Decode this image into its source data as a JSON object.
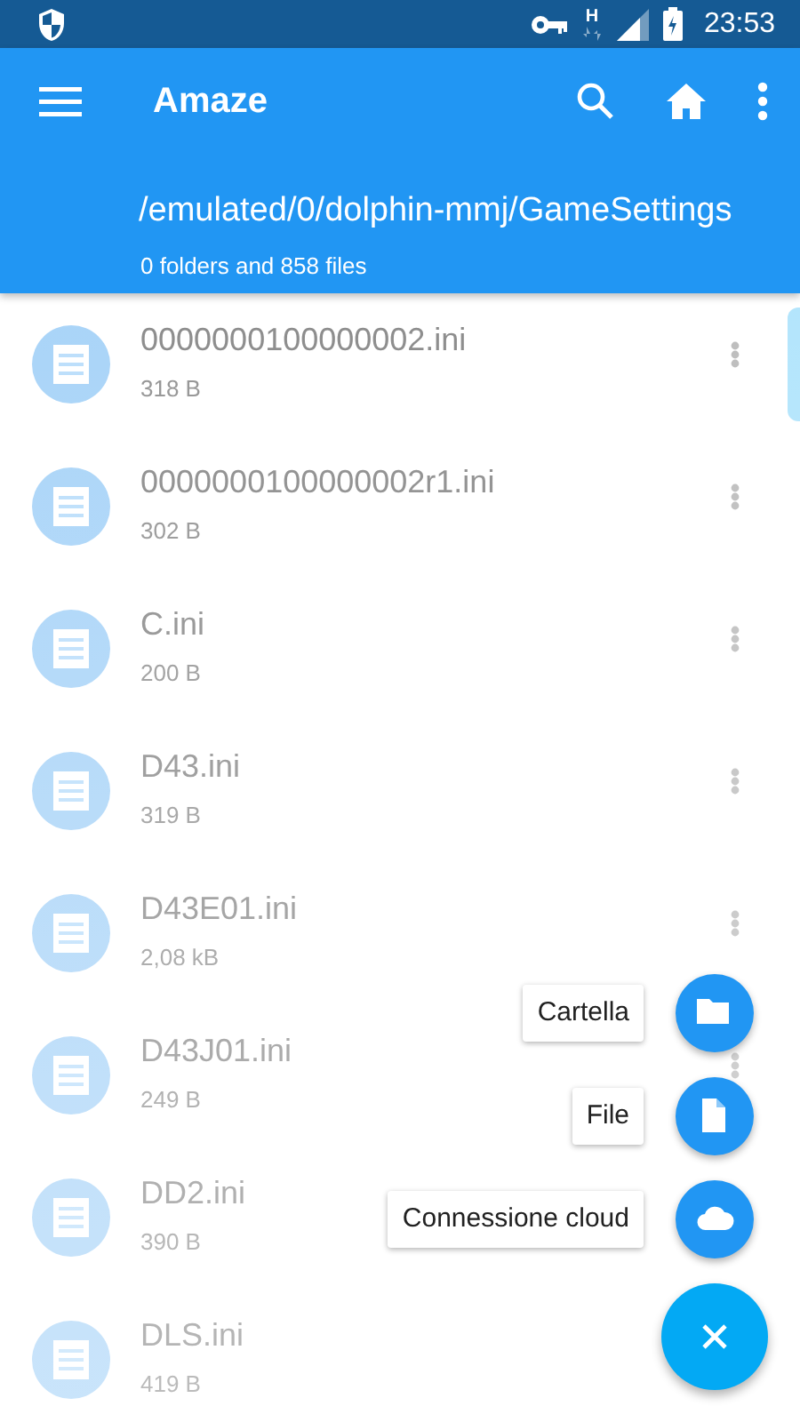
{
  "status_bar": {
    "network": "H",
    "time": "23:53"
  },
  "app_bar": {
    "title": "Amaze",
    "path": "/emulated/0/dolphin-mmj/GameSettings",
    "summary": "0 folders and 858 files"
  },
  "files": [
    {
      "name": "0000000100000002.ini",
      "size": "318 B"
    },
    {
      "name": "0000000100000002r1.ini",
      "size": "302 B"
    },
    {
      "name": "C.ini",
      "size": "200 B"
    },
    {
      "name": "D43.ini",
      "size": "319 B"
    },
    {
      "name": "D43E01.ini",
      "size": "2,08 kB"
    },
    {
      "name": "D43J01.ini",
      "size": "249 B"
    },
    {
      "name": "DD2.ini",
      "size": "390 B"
    },
    {
      "name": "DLS.ini",
      "size": "419 B"
    }
  ],
  "speed_dial": {
    "expanded": true,
    "actions": [
      {
        "kind": "folder",
        "label": "Cartella"
      },
      {
        "kind": "file",
        "label": "File"
      },
      {
        "kind": "cloud",
        "label": "Connessione cloud"
      }
    ]
  }
}
